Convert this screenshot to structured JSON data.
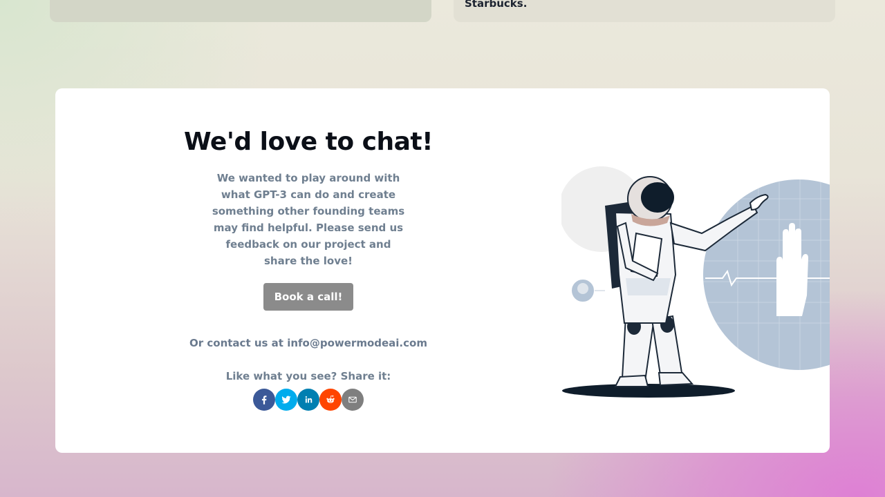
{
  "top_cards": {
    "right_text": "Starbucks."
  },
  "cta": {
    "title": "We'd love to chat!",
    "description": "We wanted to play around with what GPT-3 can do and create something other founding teams may find helpful. Please send us feedback on our project and share the love!",
    "button_label": "Book a call!",
    "contact_prefix": "Or contact us at",
    "contact_email": "info@powermodeai.com",
    "share_label": "Like what you see? Share it:"
  },
  "share_buttons": [
    {
      "name": "facebook",
      "icon": "facebook-icon",
      "color": "#3b5998"
    },
    {
      "name": "twitter",
      "icon": "twitter-icon",
      "color": "#00aced"
    },
    {
      "name": "linkedin",
      "icon": "linkedin-icon",
      "color": "#007fb1"
    },
    {
      "name": "reddit",
      "icon": "reddit-icon",
      "color": "#ff4500"
    },
    {
      "name": "email",
      "icon": "email-icon",
      "color": "#7f7f7f"
    }
  ],
  "illustration": {
    "icon": "astronaut-illustration"
  }
}
